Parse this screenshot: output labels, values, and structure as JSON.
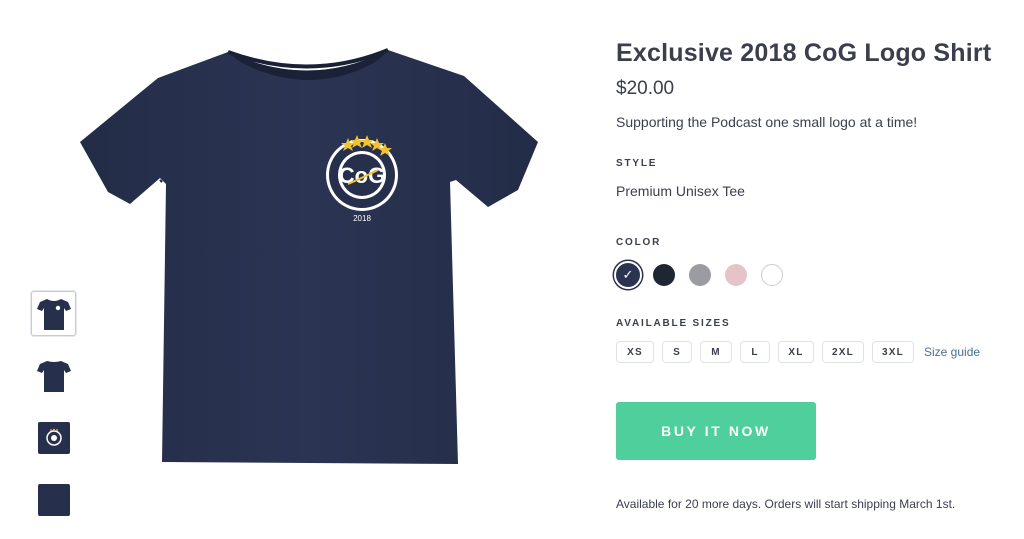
{
  "product": {
    "title": "Exclusive 2018 CoG Logo Shirt",
    "price": "$20.00",
    "description": "Supporting the Podcast one small logo at a time!",
    "logo_text": "CoG",
    "logo_year": "2018"
  },
  "style": {
    "label": "STYLE",
    "value": "Premium Unisex Tee"
  },
  "color": {
    "label": "COLOR",
    "options": [
      {
        "name": "navy",
        "hex": "#2b3350",
        "selected": true
      },
      {
        "name": "black",
        "hex": "#1f2633",
        "selected": false
      },
      {
        "name": "heather-grey",
        "hex": "#9a9ca1",
        "selected": false
      },
      {
        "name": "pink",
        "hex": "#e6c3c8",
        "selected": false
      },
      {
        "name": "white",
        "hex": "#ffffff",
        "selected": false
      }
    ],
    "check": "✓"
  },
  "sizes": {
    "label": "AVAILABLE SIZES",
    "options": [
      "XS",
      "S",
      "M",
      "L",
      "XL",
      "2XL",
      "3XL"
    ],
    "guide_label": "Size guide"
  },
  "buy_label": "BUY IT NOW",
  "availability": "Available for 20 more days. Orders will start shipping March 1st.",
  "thumbnails": [
    {
      "name": "front-shirt",
      "active": true
    },
    {
      "name": "back-shirt",
      "active": false
    },
    {
      "name": "logo-closeup",
      "active": false
    },
    {
      "name": "fabric-swatch",
      "active": false
    }
  ],
  "colors": {
    "shirt": "#26304d",
    "accent": "#4fcf9b",
    "star": "#f2c230",
    "text": "#3b3f4c"
  }
}
